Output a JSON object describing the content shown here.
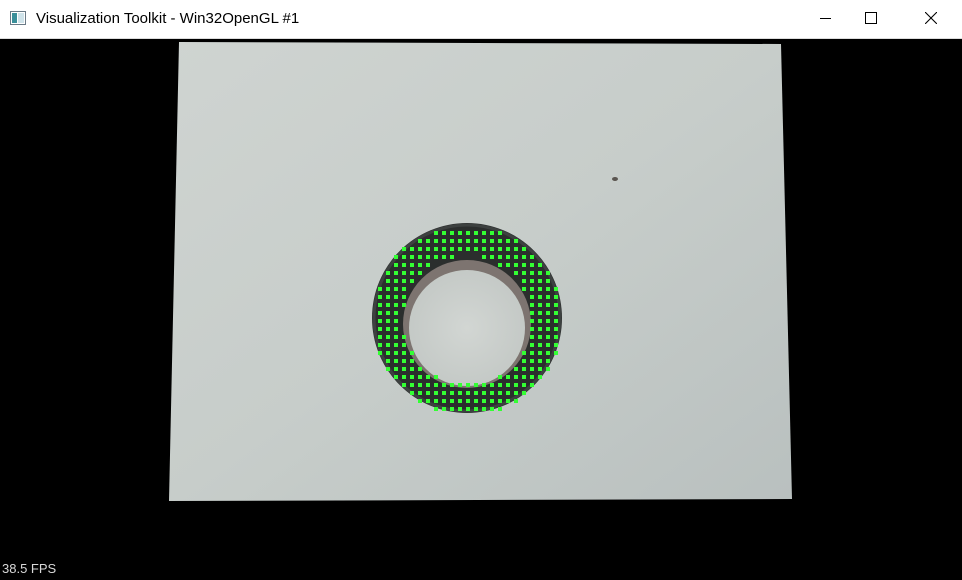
{
  "window": {
    "title": "Visualization Toolkit - Win32OpenGL #1",
    "icon": "app-window-icon",
    "controls": {
      "minimize_icon": "minimize-icon",
      "maximize_icon": "maximize-icon",
      "close_icon": "close-icon"
    }
  },
  "viewport": {
    "background_color": "#000000",
    "paper_color": "#c9cfcc",
    "ring_color": "#2a2d2c",
    "point_color": "#33ff33",
    "fps_text": "38.5 FPS"
  }
}
